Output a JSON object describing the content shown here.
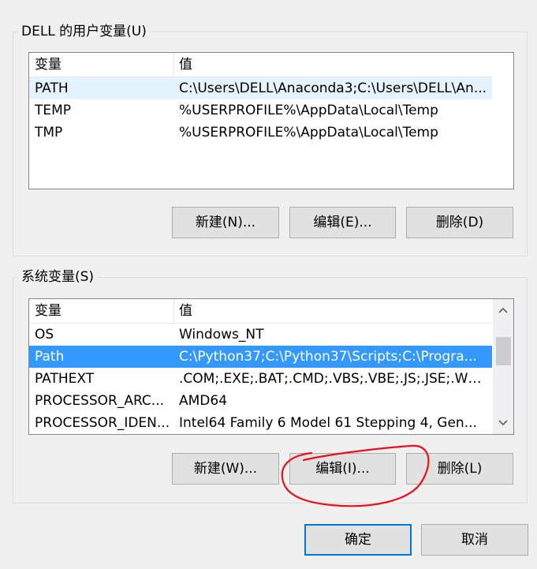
{
  "user_vars": {
    "group_title": "DELL 的用户变量(U)",
    "columns": [
      "变量",
      "值"
    ],
    "rows": [
      {
        "name": "PATH",
        "value": "C:\\Users\\DELL\\Anaconda3;C:\\Users\\DELL\\An..."
      },
      {
        "name": "TEMP",
        "value": "%USERPROFILE%\\AppData\\Local\\Temp"
      },
      {
        "name": "TMP",
        "value": "%USERPROFILE%\\AppData\\Local\\Temp"
      }
    ],
    "buttons": {
      "new": "新建(N)...",
      "edit": "编辑(E)...",
      "delete": "删除(D)"
    }
  },
  "system_vars": {
    "group_title": "系统变量(S)",
    "columns": [
      "变量",
      "值"
    ],
    "rows": [
      {
        "name": "OS",
        "value": "Windows_NT"
      },
      {
        "name": "Path",
        "value": "C:\\Python37;C:\\Python37\\Scripts;C:\\Progra..."
      },
      {
        "name": "PATHEXT",
        "value": ".COM;.EXE;.BAT;.CMD;.VBS;.VBE;.JS;.JSE;.WSF;...."
      },
      {
        "name": "PROCESSOR_ARC...",
        "value": "AMD64"
      },
      {
        "name": "PROCESSOR_IDEN...",
        "value": "Intel64 Family 6 Model 61 Stepping 4, Gen..."
      }
    ],
    "selected_row": "Path",
    "buttons": {
      "new": "新建(W)...",
      "edit": "编辑(I)...",
      "delete": "删除(L)"
    }
  },
  "dialog_buttons": {
    "ok": "确定",
    "cancel": "取消"
  },
  "colors": {
    "selection": "#3399ff",
    "hover": "#e5f3ff",
    "annotation": "#e8101a",
    "default_button_border": "#0078d7"
  },
  "icons": {
    "scroll_up": "chevron-up-icon",
    "scroll_down": "chevron-down-icon"
  }
}
